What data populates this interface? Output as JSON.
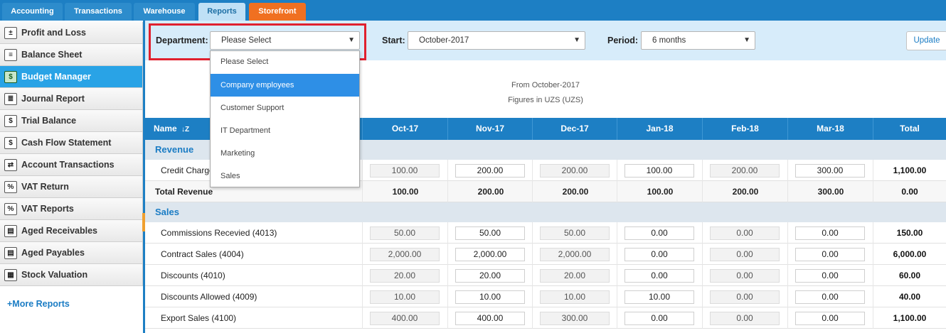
{
  "tabs": [
    {
      "label": "Accounting",
      "state": "normal"
    },
    {
      "label": "Transactions",
      "state": "normal"
    },
    {
      "label": "Warehouse",
      "state": "normal"
    },
    {
      "label": "Reports",
      "state": "active"
    },
    {
      "label": "Storefront",
      "state": "store"
    }
  ],
  "sidebar": {
    "items": [
      {
        "label": "Profit and Loss",
        "icon": "profit-loss-icon",
        "glyph": "±"
      },
      {
        "label": "Balance Sheet",
        "icon": "balance-sheet-icon",
        "glyph": "≡"
      },
      {
        "label": "Budget Manager",
        "icon": "budget-manager-icon",
        "glyph": "$",
        "active": true
      },
      {
        "label": "Journal Report",
        "icon": "journal-icon",
        "glyph": "≣"
      },
      {
        "label": "Trial Balance",
        "icon": "trial-balance-icon",
        "glyph": "$"
      },
      {
        "label": "Cash Flow Statement",
        "icon": "cash-flow-icon",
        "glyph": "$"
      },
      {
        "label": "Account Transactions",
        "icon": "account-transactions-icon",
        "glyph": "⇄"
      },
      {
        "label": "VAT Return",
        "icon": "vat-return-icon",
        "glyph": "%"
      },
      {
        "label": "VAT Reports",
        "icon": "vat-reports-icon",
        "glyph": "%"
      },
      {
        "label": "Aged Receivables",
        "icon": "aged-receivables-icon",
        "glyph": "▤"
      },
      {
        "label": "Aged Payables",
        "icon": "aged-payables-icon",
        "glyph": "▤"
      },
      {
        "label": "Stock Valuation",
        "icon": "stock-valuation-icon",
        "glyph": "▦"
      }
    ],
    "more_reports": "+More Reports"
  },
  "filters": {
    "department_label": "Department:",
    "department_value": "Please Select",
    "start_label": "Start:",
    "start_value": "October-2017",
    "period_label": "Period:",
    "period_value": "6 months",
    "update_label": "Update"
  },
  "dropdown": {
    "options": [
      "Please Select",
      "Company employees",
      "Customer Support",
      "IT Department",
      "Marketing",
      "Sales"
    ],
    "highlighted_index": 1
  },
  "info": {
    "from_text": "From October-2017",
    "figures_text": "Figures in UZS (UZS)"
  },
  "table": {
    "name_header": "Name",
    "sort_icon_glyph": "↓Z",
    "months": [
      "Oct-17",
      "Nov-17",
      "Dec-17",
      "Jan-18",
      "Feb-18",
      "Mar-18"
    ],
    "total_header": "Total",
    "sections": [
      {
        "title": "Revenue",
        "rows": [
          {
            "name": "Credit Charges",
            "values": [
              "100.00",
              "200.00",
              "200.00",
              "100.00",
              "200.00",
              "300.00"
            ],
            "total": "1,100.00"
          }
        ],
        "total_row": {
          "name": "Total Revenue",
          "values": [
            "100.00",
            "200.00",
            "200.00",
            "100.00",
            "200.00",
            "300.00"
          ],
          "total": "0.00"
        }
      },
      {
        "title": "Sales",
        "rows": [
          {
            "name": "Commissions Recevied (4013)",
            "values": [
              "50.00",
              "50.00",
              "50.00",
              "0.00",
              "0.00",
              "0.00"
            ],
            "total": "150.00"
          },
          {
            "name": "Contract Sales (4004)",
            "values": [
              "2,000.00",
              "2,000.00",
              "2,000.00",
              "0.00",
              "0.00",
              "0.00"
            ],
            "total": "6,000.00"
          },
          {
            "name": "Discounts (4010)",
            "values": [
              "20.00",
              "20.00",
              "20.00",
              "0.00",
              "0.00",
              "0.00"
            ],
            "total": "60.00"
          },
          {
            "name": "Discounts Allowed (4009)",
            "values": [
              "10.00",
              "10.00",
              "10.00",
              "10.00",
              "0.00",
              "0.00"
            ],
            "total": "40.00"
          },
          {
            "name": "Export Sales (4100)",
            "values": [
              "400.00",
              "400.00",
              "300.00",
              "0.00",
              "0.00",
              "0.00"
            ],
            "total": "1,100.00"
          }
        ]
      }
    ]
  }
}
